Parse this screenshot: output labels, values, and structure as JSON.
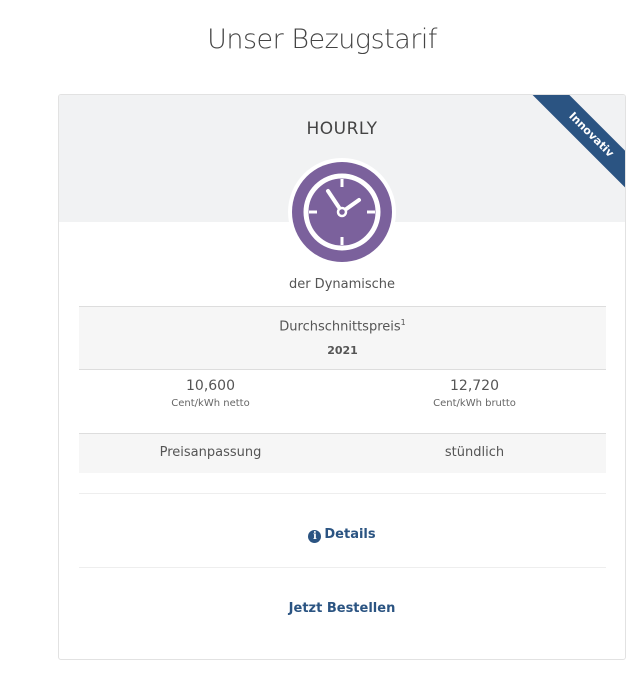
{
  "page": {
    "title": "Unser Bezugstarif"
  },
  "tariff": {
    "name": "HOURLY",
    "ribbon": "Innovativ",
    "icon": "clock-icon",
    "subtitle": "der Dynamische",
    "average_label": "Durchschnittspreis",
    "average_footnote": "1",
    "average_year": "2021",
    "net_price": "10,600",
    "net_unit": "Cent/kWh netto",
    "gross_price": "12,720",
    "gross_unit": "Cent/kWh brutto",
    "adjustment_label": "Preisanpassung",
    "adjustment_value": "stündlich",
    "details_label": "Details",
    "order_label": "Jetzt Bestellen"
  },
  "colors": {
    "accent": "#2b5482",
    "icon_purple": "#7b619c",
    "header_bg": "#f1f2f3"
  }
}
